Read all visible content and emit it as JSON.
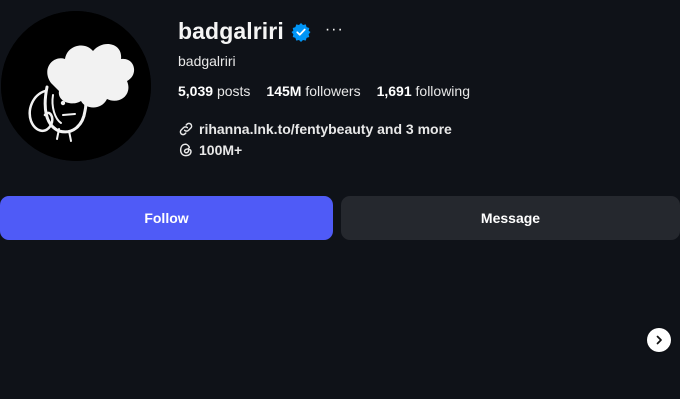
{
  "profile": {
    "username": "badgalriri",
    "full_name": "badgalriri",
    "verified_icon": "verified-badge-icon",
    "more_label": "···"
  },
  "stats": {
    "posts_count": "5,039",
    "posts_label": "posts",
    "followers_count": "145M",
    "followers_label": "followers",
    "following_count": "1,691",
    "following_label": "following"
  },
  "links": {
    "url_text": "rihanna.lnk.to/fentybeauty and 3 more",
    "link_icon": "link-icon"
  },
  "threads": {
    "count": "100M+",
    "icon": "threads-icon"
  },
  "actions": {
    "follow_label": "Follow",
    "message_label": "Message"
  },
  "colors": {
    "background": "#0f1218",
    "follow_button": "#4f5bf7",
    "message_button": "#25282e",
    "verified_badge": "#0095f6"
  }
}
